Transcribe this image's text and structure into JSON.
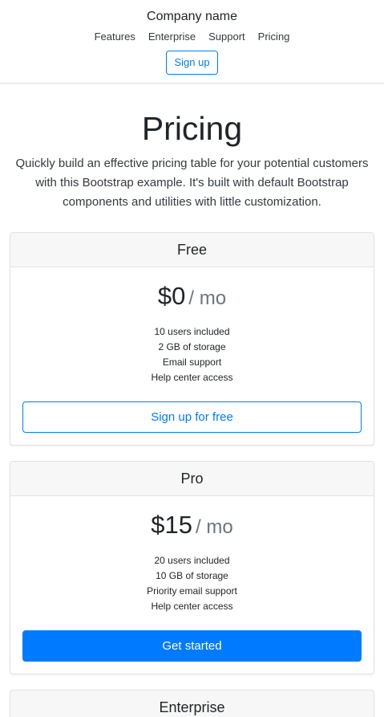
{
  "navbar": {
    "brand": "Company name",
    "links": [
      "Features",
      "Enterprise",
      "Support",
      "Pricing"
    ],
    "signup": "Sign up"
  },
  "hero": {
    "title": "Pricing",
    "lead": "Quickly build an effective pricing table for your potential customers with this Bootstrap example. It's built with default Bootstrap components and utilities with little customization."
  },
  "plans": [
    {
      "name": "Free",
      "price": "$0",
      "unit": "/ mo",
      "features": [
        "10 users included",
        "2 GB of storage",
        "Email support",
        "Help center access"
      ],
      "button": "Sign up for free"
    },
    {
      "name": "Pro",
      "price": "$15",
      "unit": "/ mo",
      "features": [
        "20 users included",
        "10 GB of storage",
        "Priority email support",
        "Help center access"
      ],
      "button": "Get started"
    },
    {
      "name": "Enterprise"
    }
  ],
  "colors": {
    "primary": "#007bff",
    "header_bg": "#f7f7f7",
    "border": "#dee2e6",
    "muted": "#6c757d"
  }
}
